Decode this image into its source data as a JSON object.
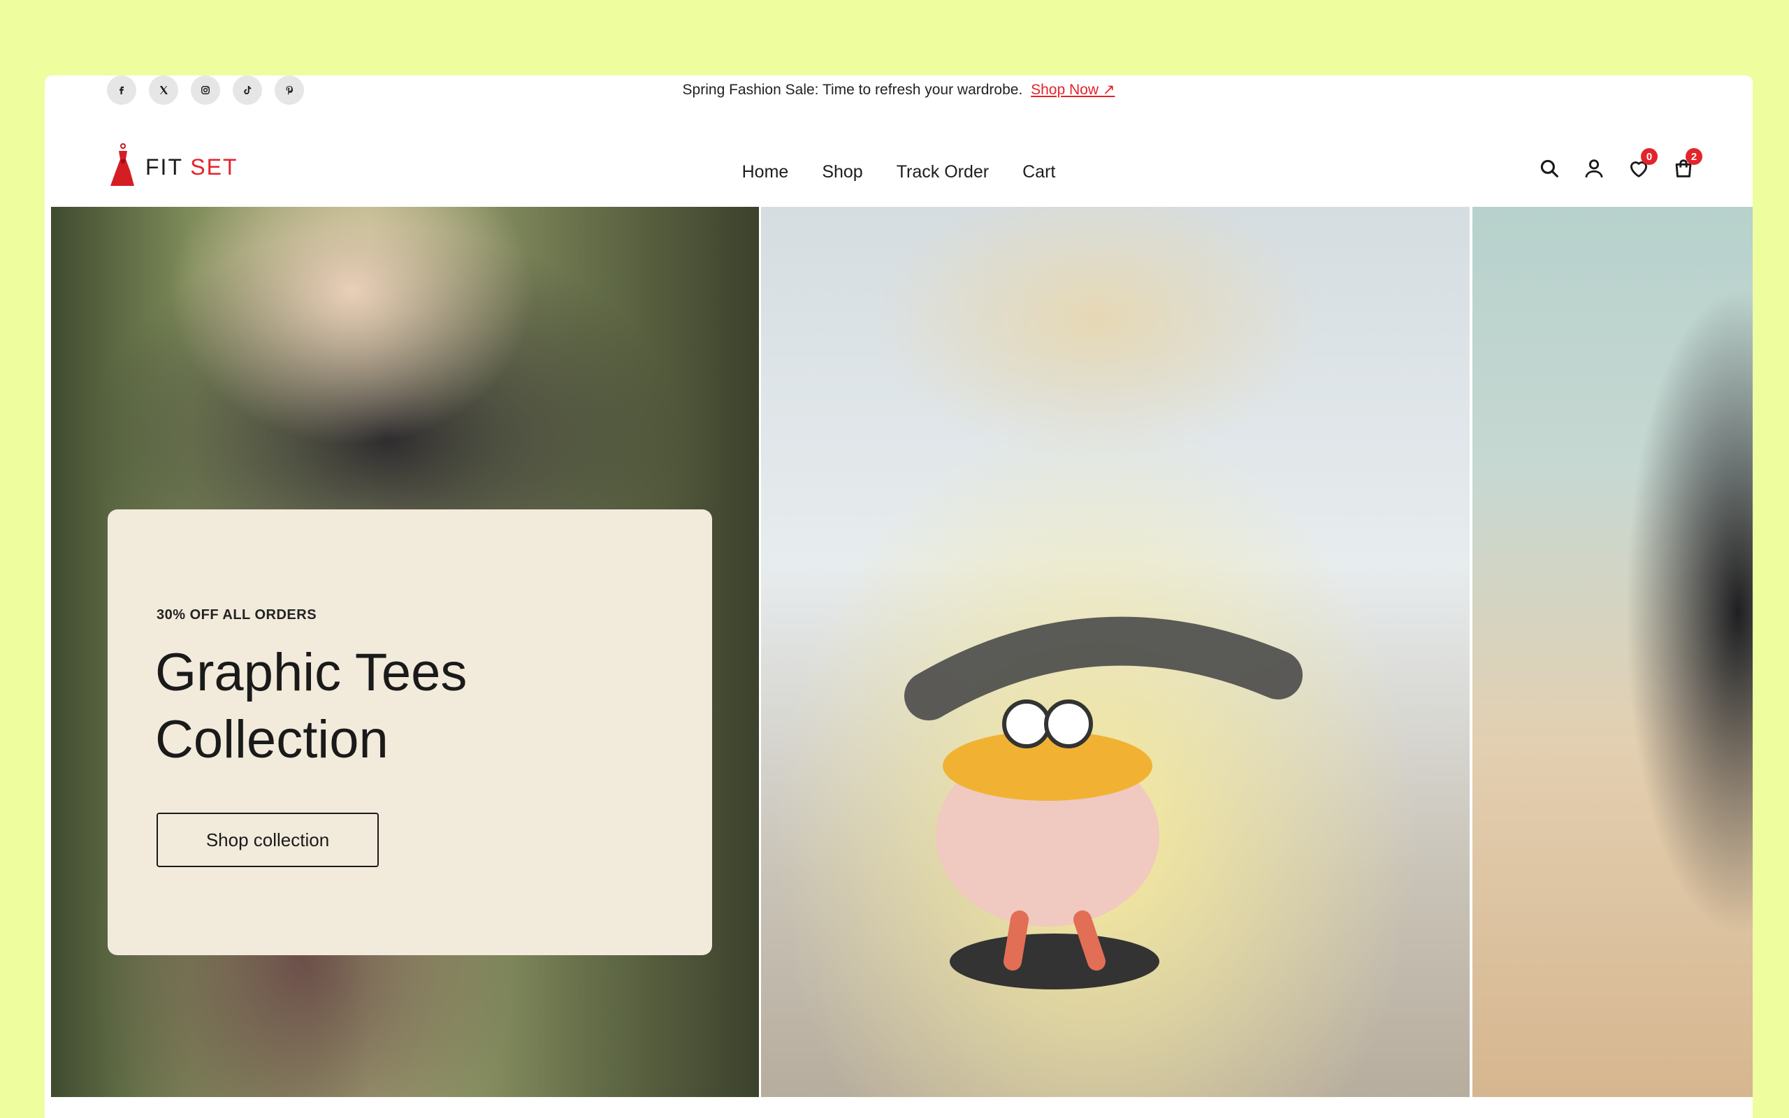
{
  "social": {
    "items": [
      {
        "name": "facebook-icon"
      },
      {
        "name": "x-twitter-icon"
      },
      {
        "name": "instagram-icon"
      },
      {
        "name": "tiktok-icon"
      },
      {
        "name": "pinterest-icon"
      }
    ]
  },
  "announcement": {
    "text": "Spring Fashion Sale: Time to refresh your wardrobe.",
    "link_label": "Shop Now ↗"
  },
  "brand": {
    "name_part1": "FIT ",
    "name_part2": "SET",
    "accent_color": "#e3242b"
  },
  "nav": {
    "home": "Home",
    "shop": "Shop",
    "track_order": "Track Order",
    "cart": "Cart"
  },
  "header_icons": {
    "wishlist_count": "0",
    "cart_count": "2"
  },
  "hero": {
    "eyebrow": "30% OFF ALL ORDERS",
    "title": "Graphic Tees Collection",
    "button_label": "Shop collection"
  },
  "colors": {
    "page_background": "#eefd9d",
    "promo_card": "#f2ebdb",
    "badge": "#e3242b"
  }
}
